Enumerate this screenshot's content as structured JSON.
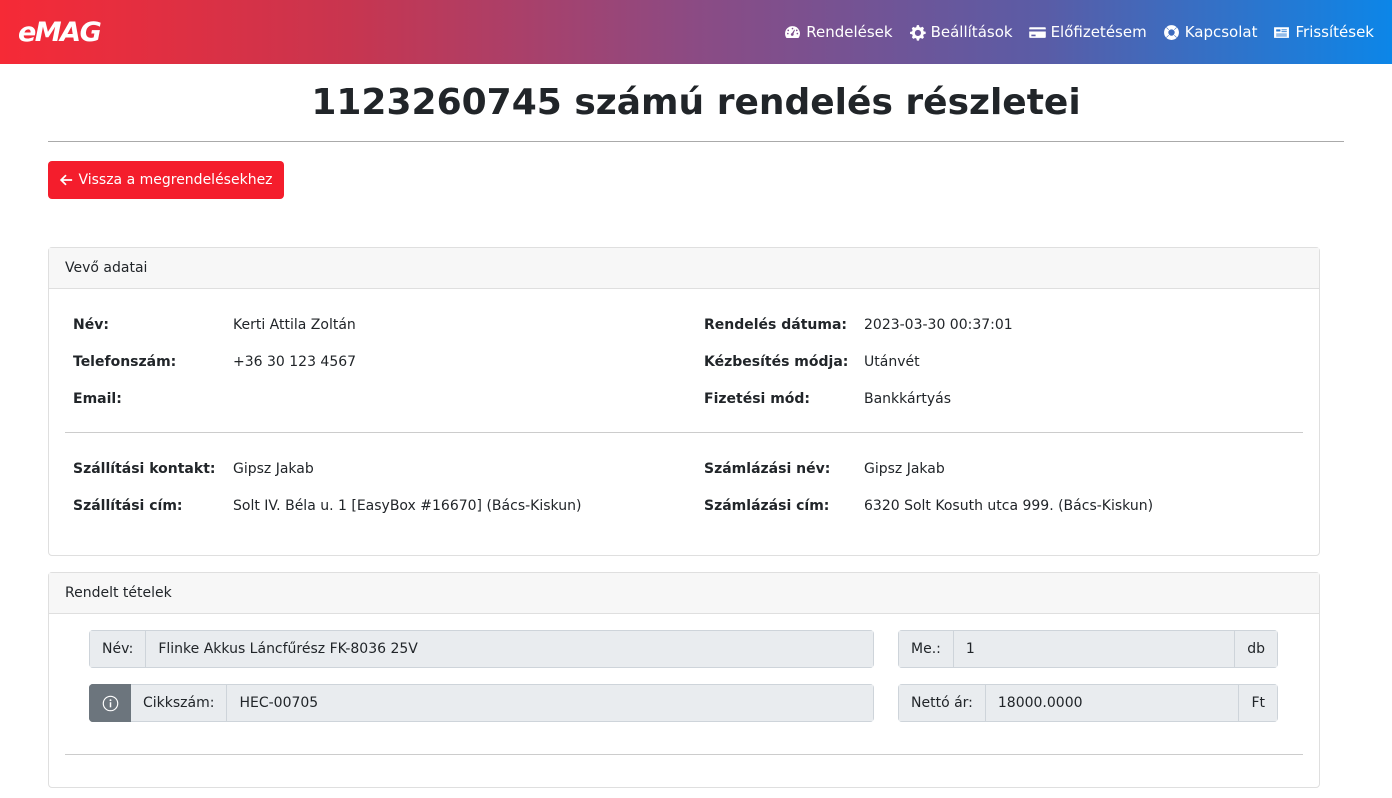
{
  "brand": {
    "logo": "eMAG"
  },
  "nav": {
    "items": [
      {
        "label": "Rendelések",
        "icon": "dashboard-icon"
      },
      {
        "label": "Beállítások",
        "icon": "gear-icon"
      },
      {
        "label": "Előfizetésem",
        "icon": "credit-card-icon"
      },
      {
        "label": "Kapcsolat",
        "icon": "lifebuoy-icon"
      },
      {
        "label": "Frissítések",
        "icon": "newspaper-icon"
      }
    ]
  },
  "page": {
    "title": "1123260745 számú rendelés részletei",
    "back_button": "Vissza a megrendelésekhez"
  },
  "customer_card": {
    "header": "Vevő adatai",
    "left": [
      {
        "label": "Név:",
        "value": "Kerti Attila Zoltán"
      },
      {
        "label": "Telefonszám:",
        "value": "+36 30 123 4567"
      },
      {
        "label": "Email:",
        "value": ""
      }
    ],
    "right": [
      {
        "label": "Rendelés dátuma:",
        "value": "2023-03-30 00:37:01"
      },
      {
        "label": "Kézbesítés módja:",
        "value": "Utánvét"
      },
      {
        "label": "Fizetési mód:",
        "value": "Bankkártyás"
      }
    ],
    "shipping": [
      {
        "label": "Szállítási kontakt:",
        "value": "Gipsz Jakab"
      },
      {
        "label": "Szállítási cím:",
        "value": "Solt IV. Béla u. 1 [EasyBox #16670] (Bács-Kiskun)"
      }
    ],
    "billing": [
      {
        "label": "Számlázási név:",
        "value": "Gipsz Jakab"
      },
      {
        "label": "Számlázási cím:",
        "value": "6320 Solt Kosuth utca 999. (Bács-Kiskun)"
      }
    ]
  },
  "items_card": {
    "header": "Rendelt tételek",
    "item": {
      "name_label": "Név:",
      "name": "Flinke Akkus Láncfűrész FK-8036 25V",
      "qty_label": "Me.:",
      "qty": "1",
      "qty_unit": "db",
      "sku_label": "Cikkszám:",
      "sku": "HEC-00705",
      "price_label": "Nettó ár:",
      "price": "18000.0000",
      "price_unit": "Ft"
    }
  }
}
